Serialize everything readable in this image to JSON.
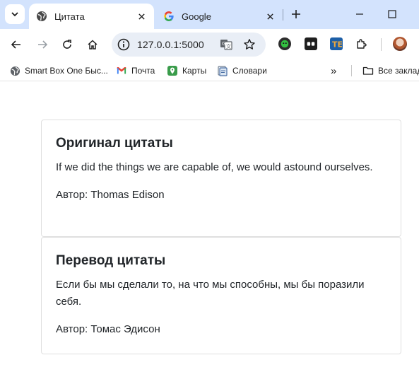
{
  "browser": {
    "tabs": [
      {
        "title": "Цитата",
        "active": true,
        "favicon": "globe-icon"
      },
      {
        "title": "Google",
        "active": false,
        "favicon": "google-g-icon"
      }
    ],
    "address_bar": {
      "url": "127.0.0.1:5000"
    },
    "bookmarks": [
      {
        "label": "Smart Box One Быс...",
        "icon": "globe-icon"
      },
      {
        "label": "Почта",
        "icon": "gmail-icon"
      },
      {
        "label": "Карты",
        "icon": "maps-icon"
      },
      {
        "label": "Словари",
        "icon": "dictionary-icon"
      }
    ],
    "bookmarks_overflow": "»",
    "all_bookmarks_label": "Все заклад"
  },
  "page": {
    "original_card": {
      "heading": "Оригинал цитаты",
      "quote": "If we did the things we are capable of, we would astound ourselves.",
      "author": "Автор: Thomas Edison"
    },
    "translation_card": {
      "heading": "Перевод цитаты",
      "quote": "Если бы мы сделали то, на что мы способны, мы бы поразили себя.",
      "author": "Автор: Томас Эдисон"
    }
  },
  "colors": {
    "tabstrip_bg": "#d3e3fd",
    "omnibox_bg": "#e9eef6",
    "text": "#212529",
    "card_border": "#dfdfdf"
  }
}
